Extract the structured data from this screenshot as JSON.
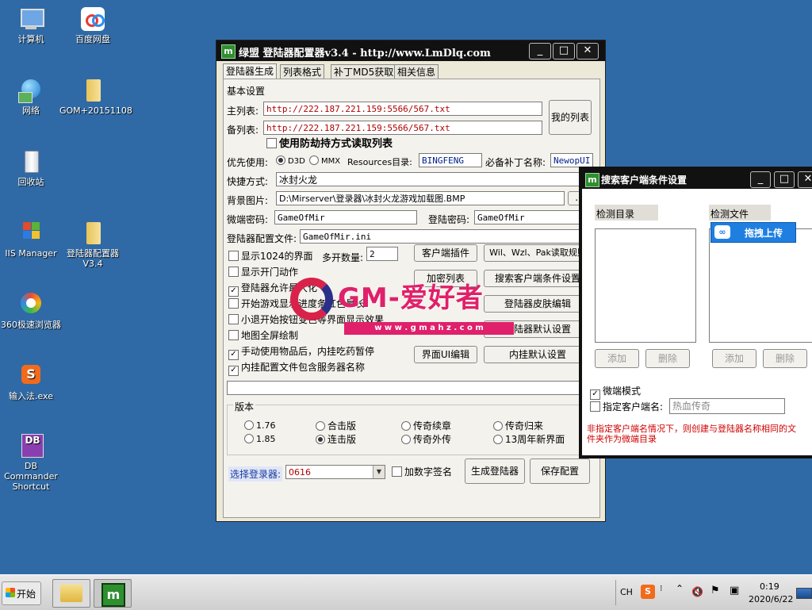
{
  "desktop": {
    "icons": [
      {
        "label": "计算机"
      },
      {
        "label": "百度网盘"
      },
      {
        "label": "网络"
      },
      {
        "label": "GOM+20151108"
      },
      {
        "label": "回收站"
      },
      {
        "label": "IIS Manager"
      },
      {
        "label": "登陆器配置器 V3.4"
      },
      {
        "label": "360极速浏览器"
      },
      {
        "label": "输入法.exe"
      },
      {
        "label": "DB Commander Shortcut"
      }
    ]
  },
  "main_window": {
    "title": "绿盟 登陆器配置器v3.4 - http://www.LmDlq.com",
    "tabs": [
      "登陆器生成",
      "列表格式",
      "补丁MD5获取",
      "相关信息"
    ],
    "basic_settings": "基本设置",
    "main_list_label": "主列表:",
    "main_list_value": "http://222.187.221.159:5566/567.txt",
    "backup_list_label": "备列表:",
    "backup_list_value": "http://222.187.221.159:5566/567.txt",
    "my_list_button": "我的列表",
    "anti_hijack": "使用防劫持方式读取列表",
    "priority_label": "优先使用:",
    "d3d": "D3D",
    "mmx": "MMX",
    "resources_label": "Resources目录:",
    "resources_value": "BINGFENG",
    "required_patch_label": "必备补丁名称:",
    "required_patch_value": "NewopUI",
    "shortcut_label": "快捷方式:",
    "shortcut_value": "冰封火龙",
    "bg_label": "背景图片:",
    "bg_value": "D:\\Mirserver\\登录器\\冰封火龙游戏加载图.BMP",
    "bg_browse": "...",
    "micro_pwd_label": "微端密码:",
    "micro_pwd_value": "GameOfMir",
    "login_pwd_label": "登陆密码:",
    "login_pwd_value": "GameOfMir",
    "config_file_label": "登陆器配置文件:",
    "config_file_value": "GameOfMir.ini",
    "options": [
      {
        "label": "显示1024的界面",
        "checked": false
      },
      {
        "label": "显示开门动作",
        "checked": false
      },
      {
        "label": "登陆器允许最大化",
        "checked": true
      },
      {
        "label": "开始游戏显示进度条红色最长",
        "checked": false
      },
      {
        "label": "小退开始按钮变色等界面显示效果",
        "checked": false
      },
      {
        "label": "地图全屏绘制",
        "checked": false
      },
      {
        "label": "手动使用物品后，内挂吃药暂停",
        "checked": true
      },
      {
        "label": "内挂配置文件包含服务器名称",
        "checked": true
      }
    ],
    "multi_open_label": "多开数量:",
    "multi_open_value": "2",
    "buttons": {
      "client_plugin": "客户端插件",
      "wil_read": "Wil、Wzl、Pak读取规则",
      "encrypt_list": "加密列表",
      "search_client_cond": "搜索客户端条件设置",
      "skin_edit": "登陆器皮肤编辑",
      "default_settings": "登陆器默认设置",
      "ui_edit": "界面UI编辑",
      "plugin_default": "内挂默认设置",
      "generate": "生成登陆器",
      "save_config": "保存配置"
    },
    "version_label": "版本",
    "versions": [
      {
        "label": "1.76",
        "checked": false
      },
      {
        "label": "合击版",
        "checked": false
      },
      {
        "label": "传奇续章",
        "checked": false
      },
      {
        "label": "传奇归来",
        "checked": false
      },
      {
        "label": "1.85",
        "checked": false
      },
      {
        "label": "连击版",
        "checked": true
      },
      {
        "label": "传奇外传",
        "checked": false
      },
      {
        "label": "13周年新界面",
        "checked": false
      }
    ],
    "select_login_label": "选择登录器:",
    "select_login_value": "0616",
    "digital_sign": "加数字签名"
  },
  "search_window": {
    "title": "搜索客户端条件设置",
    "detect_dir": "检测目录",
    "detect_file": "检测文件",
    "drag_upload": "拖拽上传",
    "add": "添加",
    "delete": "删除",
    "micro_mode": "微端模式",
    "specify_client": "指定客户端名:",
    "client_name_value": "热血传奇",
    "warning_line1": "非指定客户端名情况下，则创建与登陆器名称相同的文",
    "warning_line2": "件夹作为微端目录"
  },
  "watermark": {
    "brand": "GM-爱好者",
    "url": "w w w . g m a h z . c o m"
  },
  "taskbar": {
    "start": "开始",
    "lang": "CH",
    "time": "0:19",
    "date": "2020/6/22"
  },
  "colors": {
    "desktop": "#2f6aa6",
    "title": "#111111",
    "red_text": "#d00000",
    "watermark": "#e0206a"
  }
}
